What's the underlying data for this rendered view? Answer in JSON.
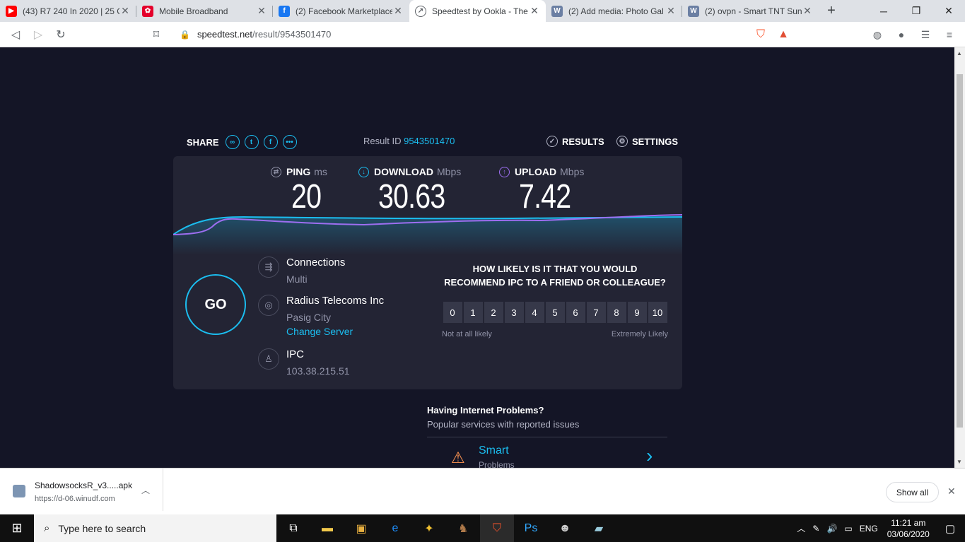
{
  "tabs": [
    {
      "title": "(43) R7 240 In 2020 | 25 C",
      "icon": "youtube-icon",
      "color": "#ff0000"
    },
    {
      "title": "Mobile Broadband",
      "icon": "huawei-icon",
      "color": "#e4002b"
    },
    {
      "title": "(2) Facebook Marketplace",
      "icon": "facebook-icon",
      "color": "#1877f2"
    },
    {
      "title": "Speedtest by Ookla - The",
      "icon": "speedtest-icon",
      "color": "#5f6368"
    },
    {
      "title": "(2) Add media: Photo Gal",
      "icon": "wordpress-icon",
      "color": "#6b7fa3"
    },
    {
      "title": "(2) ovpn - Smart TNT Sun",
      "icon": "wordpress-icon",
      "color": "#6b7fa3"
    }
  ],
  "url": {
    "host": "speedtest.net",
    "path": "/result/9543501470"
  },
  "share": {
    "label": "SHARE"
  },
  "result": {
    "label": "Result ID",
    "id": "9543501470"
  },
  "nav": {
    "results": "RESULTS",
    "settings": "SETTINGS"
  },
  "metrics": {
    "ping": {
      "label": "PING",
      "unit": "ms",
      "value": "20"
    },
    "download": {
      "label": "DOWNLOAD",
      "unit": "Mbps",
      "value": "30.63"
    },
    "upload": {
      "label": "UPLOAD",
      "unit": "Mbps",
      "value": "7.42"
    }
  },
  "go": "GO",
  "connections": {
    "label": "Connections",
    "value": "Multi"
  },
  "server": {
    "name": "Radius Telecoms Inc",
    "city": "Pasig City",
    "change": "Change Server"
  },
  "isp": {
    "name": "IPC",
    "ip": "103.38.215.51"
  },
  "survey": {
    "question": "HOW LIKELY IS IT THAT YOU WOULD RECOMMEND IPC TO A FRIEND OR COLLEAGUE?",
    "scale": [
      "0",
      "1",
      "2",
      "3",
      "4",
      "5",
      "6",
      "7",
      "8",
      "9",
      "10"
    ],
    "low": "Not at all likely",
    "high": "Extremely Likely"
  },
  "problems": {
    "heading": "Having Internet Problems?",
    "sub": "Popular services with reported issues",
    "item": "Smart",
    "item_sub": "Problems"
  },
  "download_item": {
    "file": "ShadowsocksR_v3.....apk",
    "source": "https://d-06.winudf.com",
    "show_all": "Show all"
  },
  "taskbar": {
    "search": "Type here to search",
    "lang": "ENG",
    "time": "11:21 am",
    "date": "03/06/2020"
  },
  "colors": {
    "accent": "#1bbdef",
    "upload": "#9d6ef0",
    "bg": "#141526",
    "card": "#232434"
  }
}
